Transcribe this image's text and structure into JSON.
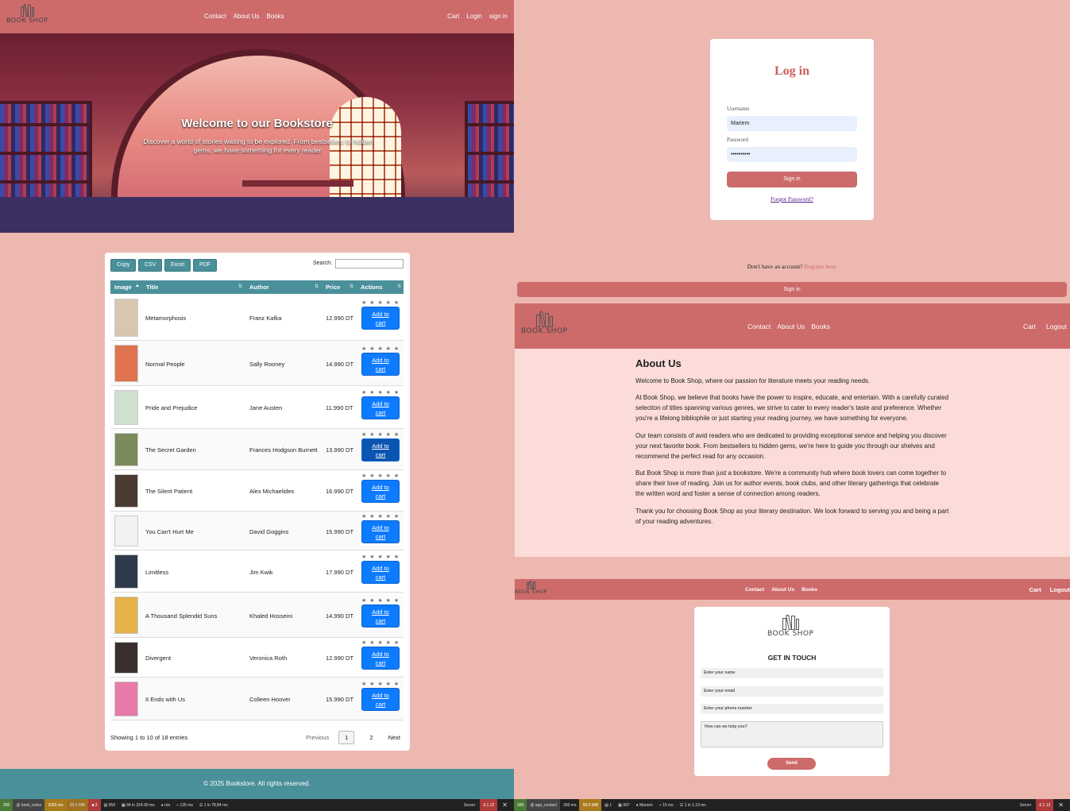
{
  "brand": {
    "logo_text": "BOOK SHOP"
  },
  "index_page": {
    "nav": {
      "links": [
        "Contact",
        "About Us",
        "Books"
      ],
      "right_links": [
        "Cart",
        "Login",
        "sign in"
      ]
    },
    "hero": {
      "title": "Welcome to our Bookstore",
      "subtitle": "Discover a world of stories waiting to be explored. From bestsellers to hidden gems, we have something for every reader."
    },
    "toolbar": {
      "buttons": [
        "Copy",
        "CSV",
        "Excel",
        "PDF"
      ],
      "search_label": "Search:",
      "search_value": ""
    },
    "table": {
      "columns": [
        "Image",
        "Title",
        "Author",
        "Price",
        "Actions"
      ],
      "stars": "★ ★ ★ ★ ★",
      "cart_label_1": "Add to",
      "cart_label_2": "cart",
      "rows": [
        {
          "title": "Metamorphosis",
          "author": "Franz Kafka",
          "price": "12.990 DT",
          "cover": "#d9c6b0"
        },
        {
          "title": "Normal People",
          "author": "Sally Rooney",
          "price": "14.990 DT",
          "cover": "#e0734f"
        },
        {
          "title": "Pride and Prejudice",
          "author": "Jane Austen",
          "price": "11.990 DT",
          "cover": "#cfe0cf"
        },
        {
          "title": "The Secret Garden",
          "author": "Frances Hodgson Burnett",
          "price": "13.990 DT",
          "cover": "#7a8a5a"
        },
        {
          "title": "The Silent Patient",
          "author": "Alex Michaelides",
          "price": "16.990 DT",
          "cover": "#4a3a32"
        },
        {
          "title": "You Can't Hurt Me",
          "author": "David Goggins",
          "price": "15.990 DT",
          "cover": "#f2f2f2"
        },
        {
          "title": "Limitless",
          "author": "Jim Kwik",
          "price": "17.990 DT",
          "cover": "#2f3a4a"
        },
        {
          "title": "A Thousand Splendid Suns",
          "author": "Khaled Hosseini",
          "price": "14.990 DT",
          "cover": "#e5b14a"
        },
        {
          "title": "Divergent",
          "author": "Veronica Roth",
          "price": "12.990 DT",
          "cover": "#3a2f2f"
        },
        {
          "title": "It Ends with Us",
          "author": "Colleen Hoover",
          "price": "15.990 DT",
          "cover": "#e77aa8"
        }
      ]
    },
    "pagination": {
      "showing": "Showing 1 to 10 of 18 entries",
      "previous": "Previous",
      "pages": [
        "1",
        "2"
      ],
      "next": "Next"
    },
    "footer": "© 2025 Bookstore. All rights reserved."
  },
  "login": {
    "title": "Log in",
    "username_label": "Username",
    "username_value": "Mariem",
    "password_label": "Password",
    "password_value": "••••••••••",
    "signin_button": "Sign in",
    "forgot": "Forgot Password?",
    "no_account": "Don't have an account?",
    "register": "Register here",
    "signin_bar": "Sign in"
  },
  "about_page": {
    "nav": {
      "links": [
        "Contact",
        "About Us",
        "Books"
      ],
      "right_links": [
        "Cart",
        "Logout"
      ]
    },
    "heading": "About Us",
    "paragraphs": [
      "Welcome to Book Shop, where our passion for literature meets your reading needs.",
      "At Book Shop, we believe that books have the power to inspire, educate, and entertain. With a carefully curated selection of titles spanning various genres, we strive to cater to every reader's taste and preference. Whether you're a lifelong bibliophile or just starting your reading journey, we have something for everyone.",
      "Our team consists of avid readers who are dedicated to providing exceptional service and helping you discover your next favorite book. From bestsellers to hidden gems, we're here to guide you through our shelves and recommend the perfect read for any occasion.",
      "But Book Shop is more than just a bookstore. We're a community hub where book lovers can come together to share their love of reading. Join us for author events, book clubs, and other literary gatherings that celebrate the written word and foster a sense of connection among readers.",
      "Thank you for choosing Book Shop as your literary destination. We look forward to serving you and being a part of your reading adventures."
    ]
  },
  "contact_page": {
    "nav": {
      "links": [
        "Contact",
        "About Us",
        "Books"
      ],
      "right_links": [
        "Cart",
        "Logout"
      ]
    },
    "heading": "GET IN TOUCH",
    "name_placeholder": "Enter your name",
    "email_placeholder": "Enter your email",
    "phone_placeholder": "Enter your phone number",
    "message_placeholder": "How can we help you?",
    "send": "Send"
  },
  "debug_left": {
    "status": "200",
    "route": "@ book_index",
    "time": "3355 ms",
    "memory": "28.0 MiB",
    "errors": "3",
    "logs": "959",
    "cache": "94 in 324.90 ms",
    "user": "n/a",
    "twig": "135 ms",
    "db": "1 in 78.84 ms",
    "server": "Server",
    "version": "6.1.12"
  },
  "debug_right": {
    "status": "200",
    "route": "@ app_contact",
    "time": "393 ms",
    "memory": "58.0 MiB",
    "logs": "1",
    "cache": "997",
    "user": "Mariem",
    "twig": "15 ms",
    "db": "1 in 1.19 ms",
    "server": "Server",
    "version": "6.1.12"
  },
  "colors": {
    "nav": "#cd6a6a",
    "page_bg": "#ecb8b0",
    "teal": "#4a909a",
    "cart_blue": "#0d7bff"
  }
}
